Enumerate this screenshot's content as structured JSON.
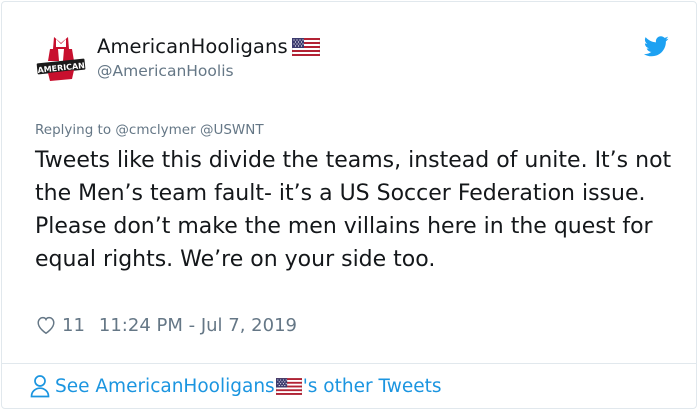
{
  "user": {
    "display_name": "AmericanHooligans",
    "handle": "@AmericanHoolis",
    "avatar_text": "AMERICAN"
  },
  "reply": {
    "prefix": "Replying to",
    "mentions": [
      "@cmclymer",
      "@USWNT"
    ]
  },
  "tweet": {
    "text": "Tweets like this divide the teams, instead of unite. It’s not the Men’s team fault- it’s a US Soccer Federation issue. Please don’t make the men villains here in the quest for equal rights. We’re on your side too."
  },
  "meta": {
    "likes": "11",
    "timestamp": "11:24 PM - Jul 7, 2019"
  },
  "footer": {
    "prefix": "See AmericanHooligans",
    "suffix": "'s other Tweets"
  },
  "icons": {
    "flag": "us-flag-icon",
    "bird": "twitter-bird-icon",
    "heart": "heart-icon",
    "person": "person-icon"
  },
  "colors": {
    "link": "#1b95e0",
    "muted": "#657786",
    "text": "#14171a",
    "twitter_blue": "#1da1f2",
    "border": "#e1e8ed"
  }
}
